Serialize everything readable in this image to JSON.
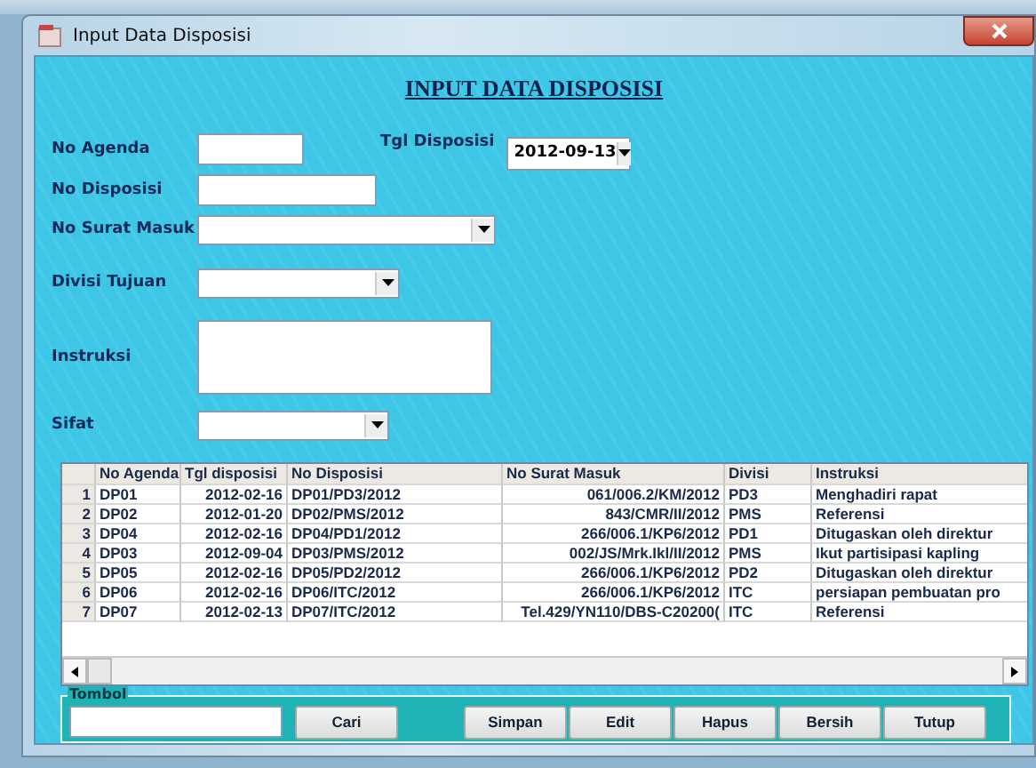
{
  "window": {
    "title": "Input Data Disposisi"
  },
  "heading": "INPUT DATA DISPOSISI",
  "form": {
    "no_agenda": {
      "label": "No Agenda"
    },
    "tgl_disposisi": {
      "label": "Tgl Disposisi",
      "value": "2012-09-13"
    },
    "no_disposisi": {
      "label": "No Disposisi"
    },
    "no_surat_masuk": {
      "label": "No Surat Masuk"
    },
    "divisi_tujuan": {
      "label": "Divisi Tujuan"
    },
    "instruksi": {
      "label": "Instruksi"
    },
    "sifat": {
      "label": "Sifat"
    }
  },
  "table": {
    "columns": [
      "No Agenda",
      "Tgl disposisi",
      "No Disposisi",
      "No Surat Masuk",
      "Divisi",
      "Instruksi"
    ],
    "rows": [
      {
        "num": "1",
        "cells": [
          "DP01",
          "2012-02-16",
          "DP01/PD3/2012",
          "061/006.2/KM/2012",
          "PD3",
          "Menghadiri rapat"
        ]
      },
      {
        "num": "2",
        "cells": [
          "DP02",
          "2012-01-20",
          "DP02/PMS/2012",
          "843/CMR/II/2012",
          "PMS",
          "Referensi"
        ]
      },
      {
        "num": "3",
        "cells": [
          "DP04",
          "2012-02-16",
          "DP04/PD1/2012",
          "266/006.1/KP6/2012",
          "PD1",
          "Ditugaskan oleh direktur"
        ]
      },
      {
        "num": "4",
        "cells": [
          "DP03",
          "2012-09-04",
          "DP03/PMS/2012",
          "002/JS/Mrk.Ikl/II/2012",
          "PMS",
          "Ikut partisipasi kapling"
        ]
      },
      {
        "num": "5",
        "cells": [
          "DP05",
          "2012-02-16",
          "DP05/PD2/2012",
          "266/006.1/KP6/2012",
          "PD2",
          "Ditugaskan oleh direktur"
        ]
      },
      {
        "num": "6",
        "cells": [
          "DP06",
          "2012-02-16",
          "DP06/ITC/2012",
          "266/006.1/KP6/2012",
          "ITC",
          "persiapan pembuatan pro"
        ]
      },
      {
        "num": "7",
        "cells": [
          "DP07",
          "2012-02-13",
          "DP07/ITC/2012",
          "Tel.429/YN110/DBS-C20200(",
          "ITC",
          "Referensi"
        ]
      }
    ]
  },
  "tombol": {
    "title": "Tombol",
    "search_button": "Cari",
    "buttons": [
      "Simpan",
      "Edit",
      "Hapus",
      "Bersih",
      "Tutup"
    ]
  }
}
